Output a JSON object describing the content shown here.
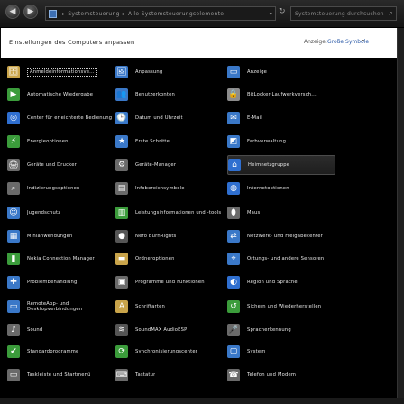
{
  "toolbar": {
    "address_parts": [
      "Systemsteuerung",
      "Alle Systemsteuerungselemente"
    ],
    "search_placeholder": "Systemsteuerung durchsuchen"
  },
  "header": {
    "title": "Einstellungen des Computers anpassen",
    "view_label": "Anzeige:",
    "view_value": "Große Symbole"
  },
  "items": [
    {
      "label": "Anmeldeinformationsve...",
      "icon": "credential-manager-icon",
      "color": "#c9a44a"
    },
    {
      "label": "Anpassung",
      "icon": "personalization-icon",
      "color": "#3a78c8"
    },
    {
      "label": "Anzeige",
      "icon": "display-icon",
      "color": "#3a78c8"
    },
    {
      "label": "Automatische Wiedergabe",
      "icon": "autoplay-icon",
      "color": "#3b9c3b"
    },
    {
      "label": "Benutzerkonten",
      "icon": "user-accounts-icon",
      "color": "#3a78c8"
    },
    {
      "label": "BitLocker-Laufwerkversch...",
      "icon": "bitlocker-icon",
      "color": "#8c8c8c"
    },
    {
      "label": "Center für erleichterte Bedienung",
      "icon": "ease-of-access-icon",
      "color": "#2f6fd0"
    },
    {
      "label": "Datum und Uhrzeit",
      "icon": "date-time-icon",
      "color": "#3a78c8"
    },
    {
      "label": "E-Mail",
      "icon": "mail-icon",
      "color": "#3a78c8"
    },
    {
      "label": "Energieoptionen",
      "icon": "power-options-icon",
      "color": "#3b9c3b"
    },
    {
      "label": "Erste Schritte",
      "icon": "getting-started-icon",
      "color": "#3a78c8"
    },
    {
      "label": "Farbverwaltung",
      "icon": "color-management-icon",
      "color": "#3a78c8"
    },
    {
      "label": "Geräte und Drucker",
      "icon": "devices-printers-icon",
      "color": "#6a6a6a"
    },
    {
      "label": "Geräte-Manager",
      "icon": "device-manager-icon",
      "color": "#6a6a6a"
    },
    {
      "label": "Heimnetzgruppe",
      "icon": "homegroup-icon",
      "color": "#2f6fd0"
    },
    {
      "label": "Indizierungsoptionen",
      "icon": "indexing-icon",
      "color": "#6a6a6a"
    },
    {
      "label": "Infobereichsymbole",
      "icon": "notification-area-icon",
      "color": "#6a6a6a"
    },
    {
      "label": "Internetoptionen",
      "icon": "internet-options-icon",
      "color": "#2f6fd0"
    },
    {
      "label": "Jugendschutz",
      "icon": "parental-controls-icon",
      "color": "#3a78c8"
    },
    {
      "label": "Leistungsinformationen und -tools",
      "icon": "performance-icon",
      "color": "#3b9c3b"
    },
    {
      "label": "Maus",
      "icon": "mouse-icon",
      "color": "#6a6a6a"
    },
    {
      "label": "Minianwendungen",
      "icon": "gadgets-icon",
      "color": "#3a78c8"
    },
    {
      "label": "Nero BurnRights",
      "icon": "nero-icon",
      "color": "#555555"
    },
    {
      "label": "Netzwerk- und Freigabecenter",
      "icon": "network-sharing-icon",
      "color": "#3a78c8"
    },
    {
      "label": "Nokia Connection Manager",
      "icon": "nokia-icon",
      "color": "#3b9c3b"
    },
    {
      "label": "Ordneroptionen",
      "icon": "folder-options-icon",
      "color": "#c9a44a"
    },
    {
      "label": "Ortungs- und andere Sensoren",
      "icon": "sensors-icon",
      "color": "#3a78c8"
    },
    {
      "label": "Problembehandlung",
      "icon": "troubleshooting-icon",
      "color": "#3a78c8"
    },
    {
      "label": "Programme und Funktionen",
      "icon": "programs-features-icon",
      "color": "#6a6a6a"
    },
    {
      "label": "Region und Sprache",
      "icon": "region-language-icon",
      "color": "#2f6fd0"
    },
    {
      "label": "RemoteApp- und Desktopverbindungen",
      "icon": "remoteapp-icon",
      "color": "#3a78c8"
    },
    {
      "label": "Schriftarten",
      "icon": "fonts-icon",
      "color": "#c9a44a"
    },
    {
      "label": "Sichern und Wiederherstellen",
      "icon": "backup-restore-icon",
      "color": "#3b9c3b"
    },
    {
      "label": "Sound",
      "icon": "sound-icon",
      "color": "#6a6a6a"
    },
    {
      "label": "SoundMAX AudioESP",
      "icon": "soundmax-icon",
      "color": "#555555"
    },
    {
      "label": "Spracherkennung",
      "icon": "speech-recognition-icon",
      "color": "#6a6a6a"
    },
    {
      "label": "Standardprogramme",
      "icon": "default-programs-icon",
      "color": "#3b9c3b"
    },
    {
      "label": "Synchronisierungscenter",
      "icon": "sync-center-icon",
      "color": "#3b9c3b"
    },
    {
      "label": "System",
      "icon": "system-icon",
      "color": "#3a78c8"
    },
    {
      "label": "Taskleiste und Startmenü",
      "icon": "taskbar-icon",
      "color": "#6a6a6a"
    },
    {
      "label": "Tastatur",
      "icon": "keyboard-icon",
      "color": "#6a6a6a"
    },
    {
      "label": "Telefon und Modem",
      "icon": "phone-modem-icon",
      "color": "#6a6a6a"
    }
  ]
}
